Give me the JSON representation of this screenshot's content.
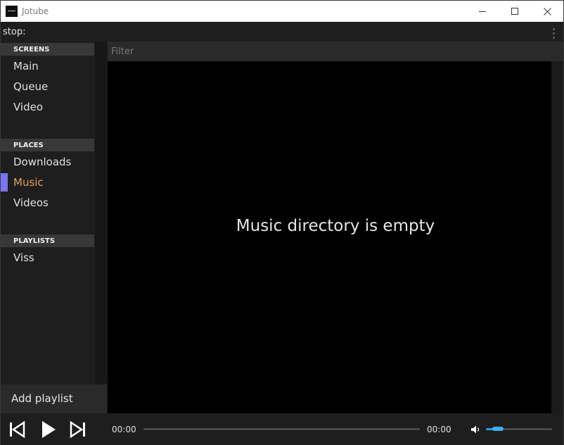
{
  "window": {
    "title": "Jotube",
    "controls": {
      "minimize": "minimize-icon",
      "maximize": "maximize-icon",
      "close": "close-icon"
    }
  },
  "status": {
    "text": "stop:"
  },
  "sidebar": {
    "sections": [
      {
        "header": "SCREENS",
        "items": [
          "Main",
          "Queue",
          "Video"
        ]
      },
      {
        "header": "PLACES",
        "items": [
          "Downloads",
          "Music",
          "Videos"
        ]
      },
      {
        "header": "PLAYLISTS",
        "items": [
          "Viss"
        ]
      }
    ],
    "active_item": "Music",
    "add_playlist_label": "Add playlist"
  },
  "filter": {
    "placeholder": "Filter",
    "value": ""
  },
  "content": {
    "empty_message": "Music directory is empty"
  },
  "player": {
    "current_time": "00:00",
    "total_time": "00:00",
    "progress": 0,
    "volume": 0.18,
    "icons": {
      "previous": "skip-previous-icon",
      "play": "play-icon",
      "next": "skip-next-icon",
      "volume": "volume-icon"
    }
  },
  "colors": {
    "active_text": "#e6a05a",
    "active_marker": "#7b74f0",
    "volume_accent": "#2b9ae0"
  }
}
